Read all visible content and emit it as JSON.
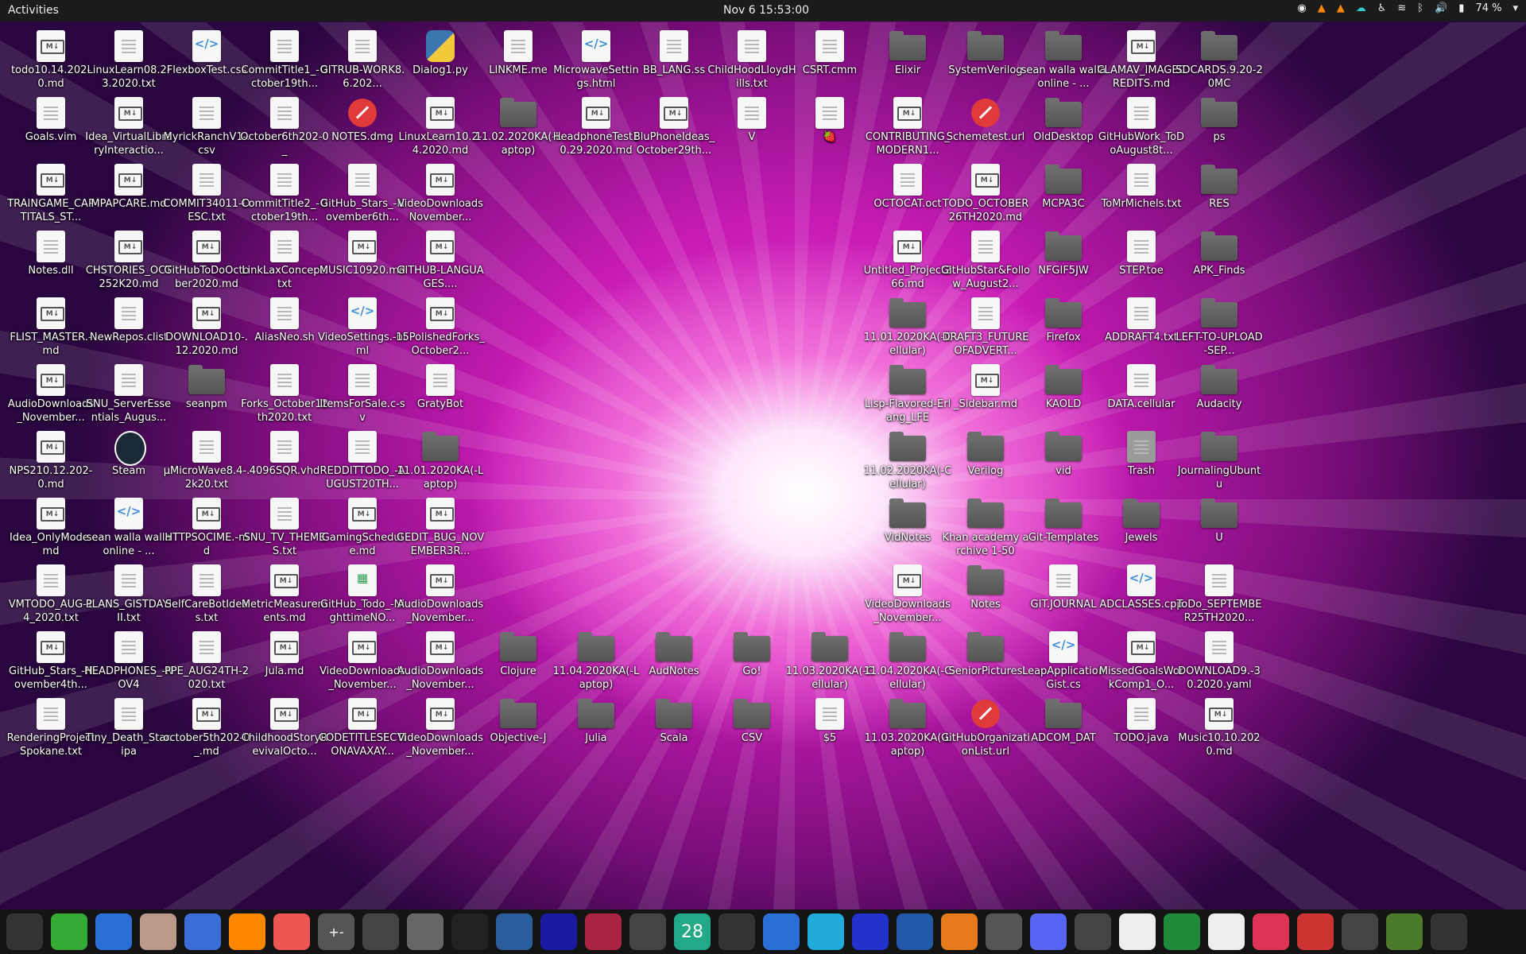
{
  "topbar": {
    "activities": "Activities",
    "clock": "Nov 6  15:53:00",
    "battery": "74 %"
  },
  "desktop": {
    "icons": [
      {
        "label": "todo10.14.202-0.md",
        "kind": "md"
      },
      {
        "label": "LinuxLearn08.2-3.2020.txt",
        "kind": "doc"
      },
      {
        "label": "FlexboxTest.css",
        "kind": "code"
      },
      {
        "label": "CommitTitle1_-October19th...",
        "kind": "doc"
      },
      {
        "label": "GITRUB-WORK8.6.202...",
        "kind": "doc"
      },
      {
        "label": "Dialog1.py",
        "kind": "py"
      },
      {
        "label": "LINKME.me",
        "kind": "doc"
      },
      {
        "label": "MicrowaveSettings.html",
        "kind": "code"
      },
      {
        "label": "BB_LANG.ss",
        "kind": "doc"
      },
      {
        "label": "ChildHoodLloydHills.txt",
        "kind": "doc"
      },
      {
        "label": "CSRT.cmm",
        "kind": "doc"
      },
      {
        "label": "Elixir",
        "kind": "folder"
      },
      {
        "label": "SystemVerilog",
        "kind": "folder"
      },
      {
        "label": "sean walla walla online - ...",
        "kind": "folder"
      },
      {
        "label": "CLAMAV_IMAGECREDITS.md",
        "kind": "md"
      },
      {
        "label": "SDCARDS.9.20-20MC",
        "kind": "folder"
      },
      {
        "label": "Goals.vim",
        "kind": "doc"
      },
      {
        "label": "Idea_VirtualLibraryInteractio...",
        "kind": "md"
      },
      {
        "label": "MyrickRanchV1-.csv",
        "kind": "doc"
      },
      {
        "label": "October6th202-0_",
        "kind": "doc"
      },
      {
        "label": "NOTES.dmg",
        "kind": "banned"
      },
      {
        "label": "LinuxLearn10.2-4.2020.md",
        "kind": "md"
      },
      {
        "label": "11.02.2020KA(-Laptop)",
        "kind": "folder"
      },
      {
        "label": "HeadphoneTest10.29.2020.md",
        "kind": "md"
      },
      {
        "label": "BluPhoneIdeas_October29th...",
        "kind": "md"
      },
      {
        "label": "V",
        "kind": "doc"
      },
      {
        "label": "🍓",
        "kind": "doc"
      },
      {
        "label": "CONTRIBUTING_MODERN1...",
        "kind": "md"
      },
      {
        "label": "Schemetest.url",
        "kind": "banned"
      },
      {
        "label": "OldDesktop",
        "kind": "folder"
      },
      {
        "label": "GitHubWork_ToDoAugust8t...",
        "kind": "doc"
      },
      {
        "label": "ps",
        "kind": "folder"
      },
      {
        "label": "TRAINGAME_CAPTITALS_ST...",
        "kind": "md"
      },
      {
        "label": "MPAPCARE.md",
        "kind": "md"
      },
      {
        "label": "COMMIT34011-DESC.txt",
        "kind": "doc"
      },
      {
        "label": "CommitTitle2_-October19th...",
        "kind": "doc"
      },
      {
        "label": "GitHub_Stars_-November6th...",
        "kind": "doc"
      },
      {
        "label": "VideoDownloadsNovember...",
        "kind": "md"
      },
      {
        "label": "OCTOCAT.oct",
        "kind": "doc"
      },
      {
        "label": "TODO_OCTOBER26TH2020.md",
        "kind": "md"
      },
      {
        "label": "MCPA3C",
        "kind": "folder"
      },
      {
        "label": "ToMrMichels.txt",
        "kind": "doc"
      },
      {
        "label": "RES",
        "kind": "folder"
      },
      {
        "label": "Notes.dll",
        "kind": "doc"
      },
      {
        "label": "CHSTORIES_OCT252K20.md",
        "kind": "md"
      },
      {
        "label": "GitHubToDoOctober2020.md",
        "kind": "md"
      },
      {
        "label": "LinkLaxConcept.txt",
        "kind": "doc"
      },
      {
        "label": "MUSIC10920.md",
        "kind": "md"
      },
      {
        "label": "GITHUB-LANGUAGES....",
        "kind": "md"
      },
      {
        "label": "Untitled_Project266.md",
        "kind": "md"
      },
      {
        "label": "GitHubStar&Follow_August2...",
        "kind": "doc"
      },
      {
        "label": "NFGIF5JW",
        "kind": "folder"
      },
      {
        "label": "STEP.toe",
        "kind": "doc"
      },
      {
        "label": "APK_Finds",
        "kind": "folder"
      },
      {
        "label": "FLIST_MASTER.-md",
        "kind": "md"
      },
      {
        "label": "NewRepos.clist",
        "kind": "doc"
      },
      {
        "label": "DOWNLOAD10-.12.2020.md",
        "kind": "md"
      },
      {
        "label": "AliasNeo.sh",
        "kind": "doc"
      },
      {
        "label": "VideoSettings.-html",
        "kind": "code"
      },
      {
        "label": "15PolishedForks_October2...",
        "kind": "md"
      },
      {
        "label": "11.01.2020KA(-Cellular)",
        "kind": "folder"
      },
      {
        "label": "DRAFT3_FUTUREOFADVERT...",
        "kind": "doc"
      },
      {
        "label": "Firefox",
        "kind": "folder"
      },
      {
        "label": "ADDRAFT4.txt",
        "kind": "doc"
      },
      {
        "label": "LEFT-TO-UPLOAD-SEP...",
        "kind": "folder"
      },
      {
        "label": "AudioDownloads_November...",
        "kind": "md"
      },
      {
        "label": "SNU_ServerEssentials_Augus...",
        "kind": "doc"
      },
      {
        "label": "seanpm",
        "kind": "folder"
      },
      {
        "label": "Forks_October12th2020.txt",
        "kind": "doc"
      },
      {
        "label": "ItemsForSale.c-sv",
        "kind": "doc"
      },
      {
        "label": "GratyBot",
        "kind": "doc"
      },
      {
        "label": "Lisp-Flavored-Erlang_LFE",
        "kind": "folder"
      },
      {
        "label": "_Sidebar.md",
        "kind": "md"
      },
      {
        "label": "KAOLD",
        "kind": "folder"
      },
      {
        "label": "DATA.cellular",
        "kind": "doc"
      },
      {
        "label": "Audacity",
        "kind": "folder"
      },
      {
        "label": "NPS210.12.202-0.md",
        "kind": "md"
      },
      {
        "label": "Steam",
        "kind": "app"
      },
      {
        "label": "μMicroWave8.4-.2k20.txt",
        "kind": "doc"
      },
      {
        "label": "4096SQR.vhd",
        "kind": "doc"
      },
      {
        "label": "REDDITTODO_-AUGUST20TH...",
        "kind": "doc"
      },
      {
        "label": "11.01.2020KA(-Laptop)",
        "kind": "folder"
      },
      {
        "label": "11.02.2020KA(-Cellular)",
        "kind": "folder"
      },
      {
        "label": "Verilog",
        "kind": "folder"
      },
      {
        "label": "vid",
        "kind": "folder"
      },
      {
        "label": "Trash",
        "kind": "trash"
      },
      {
        "label": "JournalingUbuntu",
        "kind": "folder"
      },
      {
        "label": "Idea_OnlyMode.md",
        "kind": "md"
      },
      {
        "label": "sean walla walla online - ...",
        "kind": "code"
      },
      {
        "label": "HTTPSOCIME.-md",
        "kind": "md"
      },
      {
        "label": "SNU_TV_THEMES.txt",
        "kind": "doc"
      },
      {
        "label": "GamingSchedule.md",
        "kind": "md"
      },
      {
        "label": "GEDIT_BUG_NOVEMBER3R...",
        "kind": "md"
      },
      {
        "label": "VidNotes",
        "kind": "folder"
      },
      {
        "label": "Khan academy archive 1-50",
        "kind": "folder"
      },
      {
        "label": "Git-Templates",
        "kind": "folder"
      },
      {
        "label": "Jewels",
        "kind": "folder"
      },
      {
        "label": "U",
        "kind": "folder"
      },
      {
        "label": "VMTODO_AUG-14_2020.txt",
        "kind": "doc"
      },
      {
        "label": "PLANS_GISTDAYIII.txt",
        "kind": "doc"
      },
      {
        "label": "SelfCareBotIdeas.txt",
        "kind": "doc"
      },
      {
        "label": "MetricMeasurements.md",
        "kind": "md"
      },
      {
        "label": "GitHub_Todo_-NighttimeNO...",
        "kind": "sheet"
      },
      {
        "label": "AudioDownloads_November...",
        "kind": "md"
      },
      {
        "label": "VideoDownloads_November...",
        "kind": "md"
      },
      {
        "label": "Notes",
        "kind": "folder"
      },
      {
        "label": "GIT.JOURNAL",
        "kind": "doc"
      },
      {
        "label": "ADCLASSES.cpp",
        "kind": "code"
      },
      {
        "label": "ToDo_SEPTEMBER25TH2020...",
        "kind": "doc"
      },
      {
        "label": "GitHub_Stars_-November4th...",
        "kind": "md"
      },
      {
        "label": "HEADPHONES_-NOV4",
        "kind": "doc"
      },
      {
        "label": "PPE_AUG24TH-2020.txt",
        "kind": "doc"
      },
      {
        "label": "Jula.md",
        "kind": "md"
      },
      {
        "label": "VideoDownloads_November...",
        "kind": "md"
      },
      {
        "label": "AudioDownloads_November...",
        "kind": "md"
      },
      {
        "label": "Clojure",
        "kind": "folder"
      },
      {
        "label": "11.04.2020KA(-Laptop)",
        "kind": "folder"
      },
      {
        "label": "AudNotes",
        "kind": "folder"
      },
      {
        "label": "Go!",
        "kind": "folder"
      },
      {
        "label": "11.03.2020KA(-Cellular)",
        "kind": "folder"
      },
      {
        "label": "11.04.2020KA(-Cellular)",
        "kind": "folder"
      },
      {
        "label": "SeniorPictures",
        "kind": "folder"
      },
      {
        "label": "LeapApplicationGist.cs",
        "kind": "code"
      },
      {
        "label": "MissedGoalsWorkComp1_O...",
        "kind": "md"
      },
      {
        "label": "DOWNLOAD9.-30.2020.yaml",
        "kind": "doc"
      },
      {
        "label": "RenderingProjectSpokane.txt",
        "kind": "doc"
      },
      {
        "label": "Tiny_Death_Star.ipa",
        "kind": "doc"
      },
      {
        "label": "october5th202-0_.md",
        "kind": "md"
      },
      {
        "label": "ChildhoodStoryRevivalOcto...",
        "kind": "md"
      },
      {
        "label": "CODETITLESECTIONAVAXAY...",
        "kind": "md"
      },
      {
        "label": "VideoDownloads_November...",
        "kind": "md"
      },
      {
        "label": "Objective-J",
        "kind": "folder"
      },
      {
        "label": "Julia",
        "kind": "folder"
      },
      {
        "label": "Scala",
        "kind": "folder"
      },
      {
        "label": "CSV",
        "kind": "folder"
      },
      {
        "label": "$5",
        "kind": "doc"
      },
      {
        "label": "11.03.2020KA(-Laptop)",
        "kind": "folder"
      },
      {
        "label": "GitHubOrganizationList.url",
        "kind": "banned"
      },
      {
        "label": "ADCOM_DAT",
        "kind": "folder"
      },
      {
        "label": "TODO.java",
        "kind": "doc"
      },
      {
        "label": "Music10.10.2020.md",
        "kind": "md"
      }
    ]
  },
  "dock": {
    "items": [
      "system-monitor",
      "terminal-green",
      "document",
      "files",
      "text-editor",
      "vlc",
      "firefox",
      "calculator",
      "settings",
      "image-viewer",
      "terminal",
      "photo",
      "music",
      "chart",
      "software",
      "calendar-28",
      "inkscape",
      "tasks",
      "cloud",
      "screenshot",
      "virtualbox",
      "blender",
      "gimp",
      "discord",
      "search",
      "text",
      "spreadsheet",
      "typora",
      "presentation",
      "mario",
      "weather",
      "minecraft",
      "apps-grid"
    ],
    "calendar_day": "28",
    "calc_label": "+-"
  }
}
